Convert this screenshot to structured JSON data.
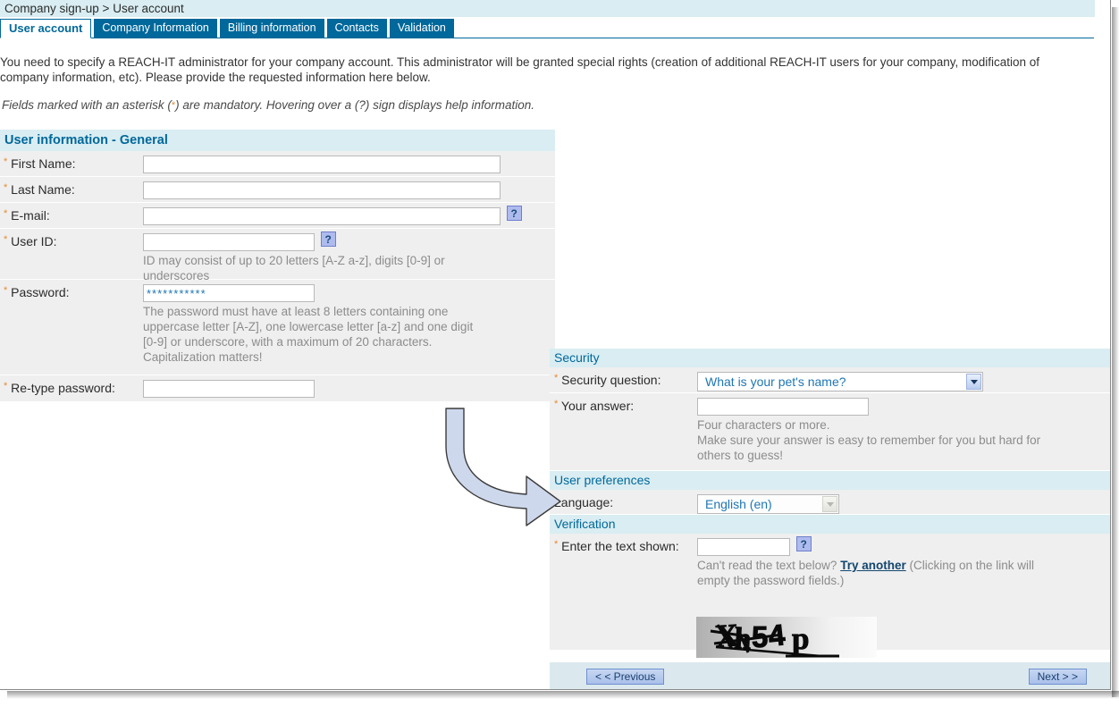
{
  "breadcrumb": "Company sign-up > User account",
  "tabs": [
    {
      "label": "User account",
      "active": true
    },
    {
      "label": "Company Information",
      "active": false
    },
    {
      "label": "Billing information",
      "active": false
    },
    {
      "label": "Contacts",
      "active": false
    },
    {
      "label": "Validation",
      "active": false
    }
  ],
  "intro": {
    "line1": "You need to specify a REACH-IT administrator for your company account. This administrator will be granted special rights (creation of additional REACH-IT users for your company, modification of",
    "line2": "company information, etc). Please provide the requested information here below.",
    "hint_before": "Fields marked with an asterisk (",
    "hint_ast": "*",
    "hint_after": ") are mandatory. Hovering over a (?) sign displays help information."
  },
  "left_panel": {
    "section_title": "User information - General",
    "fields": {
      "first_name": {
        "label": "First Name:",
        "value": "",
        "required": true
      },
      "last_name": {
        "label": "Last Name:",
        "value": "",
        "required": true
      },
      "email": {
        "label": "E-mail:",
        "value": "",
        "required": true,
        "help": "?"
      },
      "user_id": {
        "label": "User ID:",
        "value": "",
        "required": true,
        "help": "?",
        "note_line1": "ID may consist of up to 20 letters [A-Z a-z], digits [0-9] or",
        "note_line2": "underscores"
      },
      "password": {
        "label": "Password:",
        "value": "***********",
        "required": true,
        "note_line1": "The password must have at least 8 letters containing one",
        "note_line2": "uppercase letter [A-Z], one lowercase letter [a-z] and one digit",
        "note_line3": "[0-9] or underscore, with a maximum of 20 characters.",
        "note_line4": "Capitalization matters!"
      },
      "retype_password": {
        "label": "Re-type password:",
        "value": "",
        "required": true
      }
    }
  },
  "right_panel": {
    "security": {
      "section_title": "Security",
      "question": {
        "label": "Security question:",
        "required": true,
        "selected": "What is your pet's name?"
      },
      "answer": {
        "label": "Your answer:",
        "required": true,
        "value": "",
        "note_line1": "Four characters or more.",
        "note_line2": "Make sure your answer is easy to remember for you but hard for",
        "note_line3": "others to guess!"
      }
    },
    "preferences": {
      "section_title": "User preferences",
      "language": {
        "label": "Language:",
        "selected": "English (en)",
        "disabled": true
      }
    },
    "verification": {
      "section_title": "Verification",
      "captcha_field": {
        "label": "Enter the text shown:",
        "required": true,
        "value": "",
        "help": "?"
      },
      "note_before": "Can't read the text below? ",
      "note_link": "Try another",
      "note_after": " (Clicking on the link will",
      "note_line2": "empty the password fields.)",
      "captcha_text": "Xh54p"
    }
  },
  "footer": {
    "previous_label": "< < Previous",
    "next_label": "Next > >"
  },
  "colors": {
    "brand_blue": "#00689b",
    "section_header_bg": "#d9edf2",
    "row_bg": "#efefef",
    "asterisk": "#e8882a",
    "footer_bg": "#dbe9ee",
    "arrow_fill": "#ced8ed"
  }
}
